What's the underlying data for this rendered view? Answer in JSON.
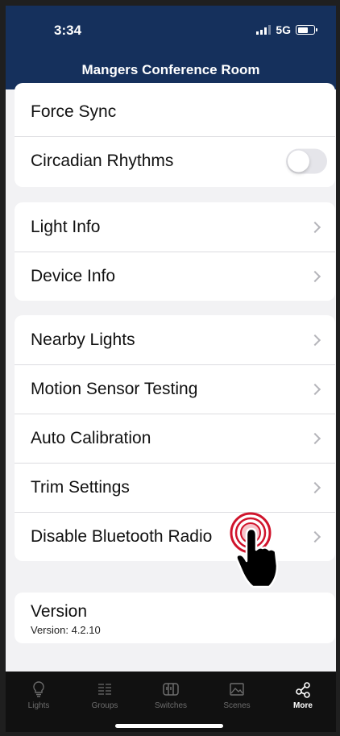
{
  "status_bar": {
    "time": "3:34",
    "network": "5G"
  },
  "header": {
    "title": "Mangers Conference Room"
  },
  "cards": {
    "top": {
      "force_sync": "Force Sync",
      "circadian": "Circadian Rhythms",
      "circadian_enabled": false
    },
    "info": {
      "light_info": "Light Info",
      "device_info": "Device Info"
    },
    "tools": {
      "nearby_lights": "Nearby Lights",
      "motion_sensor_testing": "Motion Sensor Testing",
      "auto_calibration": "Auto Calibration",
      "trim_settings": "Trim Settings",
      "disable_bluetooth": "Disable Bluetooth Radio"
    },
    "version": {
      "title": "Version",
      "value": "Version: 4.2.10"
    }
  },
  "tabbar": {
    "items": [
      {
        "label": "Lights",
        "icon": "lightbulb-icon",
        "active": false
      },
      {
        "label": "Groups",
        "icon": "grid-icon",
        "active": false
      },
      {
        "label": "Switches",
        "icon": "switch-panel-icon",
        "active": false
      },
      {
        "label": "Scenes",
        "icon": "image-icon",
        "active": false
      },
      {
        "label": "More",
        "icon": "share-nodes-icon",
        "active": true
      }
    ]
  },
  "colors": {
    "header": "#15305c",
    "tap_indicator": "#d0142c",
    "tabbar": "#111111"
  }
}
